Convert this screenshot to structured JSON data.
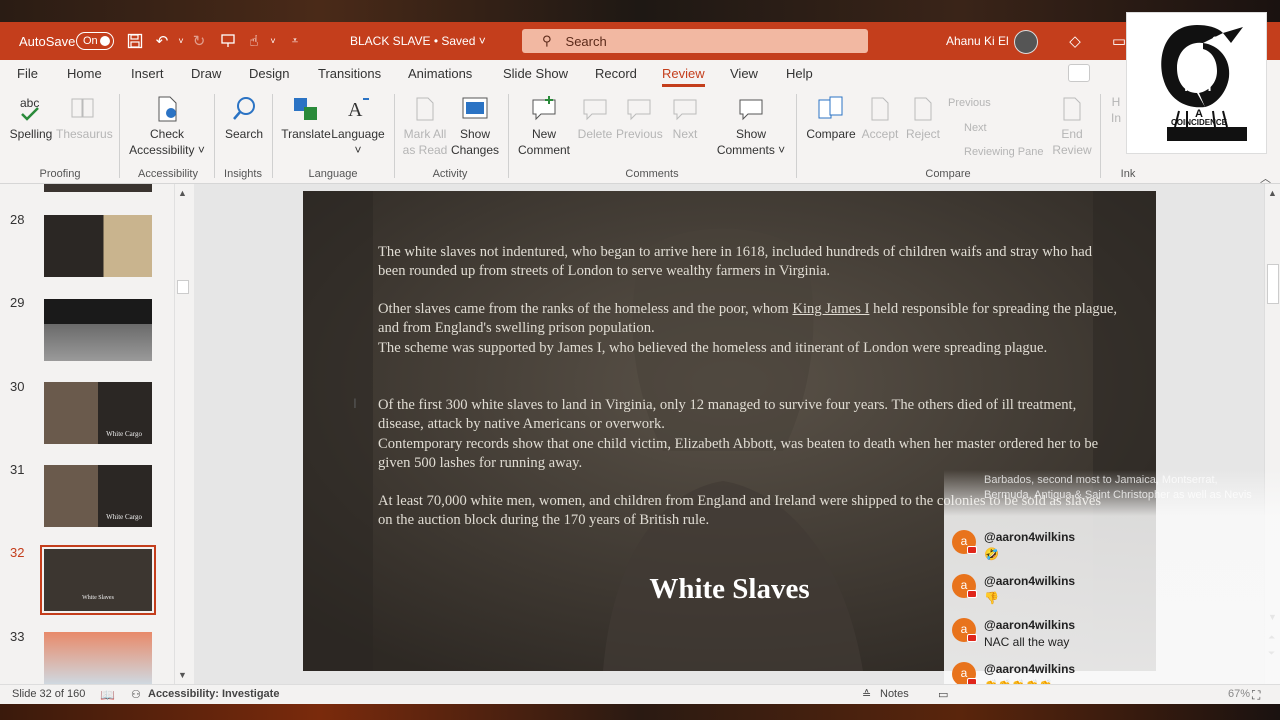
{
  "titlebar": {
    "autosave_label": "AutoSave",
    "autosave_state": "On",
    "doc_title": "BLACK SLAVE • Saved",
    "search_placeholder": "Search",
    "user_name": "Ahanu Ki El"
  },
  "tabs": [
    "File",
    "Home",
    "Insert",
    "Draw",
    "Design",
    "Transitions",
    "Animations",
    "Slide Show",
    "Record",
    "Review",
    "View",
    "Help"
  ],
  "active_tab": "Review",
  "ribbon": {
    "groups": {
      "proofing": "Proofing",
      "accessibility": "Accessibility",
      "insights": "Insights",
      "language": "Language",
      "activity": "Activity",
      "comments": "Comments",
      "compare": "Compare",
      "ink": "Ink"
    },
    "buttons": {
      "spelling": "Spelling",
      "thesaurus": "Thesaurus",
      "check_accessibility_1": "Check",
      "check_accessibility_2": "Accessibility ˅",
      "search": "Search",
      "translate": "Translate",
      "language": "Language",
      "language_arrow": "˅",
      "mark_all_1": "Mark All",
      "mark_all_2": "as Read",
      "show_changes_1": "Show",
      "show_changes_2": "Changes",
      "new_comment_1": "New",
      "new_comment_2": "Comment",
      "delete": "Delete",
      "previous": "Previous",
      "next": "Next",
      "show_comments_1": "Show",
      "show_comments_2": "Comments ˅",
      "compare": "Compare",
      "accept": "Accept",
      "reject": "Reject",
      "small_previous": "Previous",
      "small_next": "Next",
      "reviewing_pane": "Reviewing Pane",
      "end_review_1": "End",
      "end_review_2": "Review",
      "ink_1": "H",
      "ink_2": "In"
    }
  },
  "slides_panel": {
    "numbers": [
      "28",
      "29",
      "30",
      "31",
      "32",
      "33"
    ],
    "selected": "32",
    "thumb_30_text": "White Cargo",
    "thumb_31_text": "White Cargo",
    "thumb_32_text": "White Slaves"
  },
  "slide": {
    "p1": "The white slaves not indentured, who began to arrive here in 1618, included hundreds of children waifs and stray who had been rounded up from streets of London to serve wealthy farmers in Virginia.",
    "p2a": "Other slaves came from the ranks of the homeless and the poor, whom ",
    "p2_link": "King James I",
    "p2b": " held responsible for spreading the plague, and from England's swelling prison population.",
    "p3": "The scheme was supported by James I, who believed the homeless and itinerant of London were spreading plague.",
    "p4": "Of the first 300 white slaves to land in Virginia, only 12  managed to survive four years. The others died of ill treatment, disease, attack by native Americans or overwork.",
    "p5": "Contemporary records show that one child victim, Elizabeth Abbott, was beaten to death when her master ordered her to be given 500 lashes for running away.",
    "p6": "At least 70,000 white men, women, and children from England and Ireland were shipped to the colonies to be sold as slaves on the auction block during the 170 years of British rule.",
    "title": "White Slaves"
  },
  "logo": {
    "text_not": "NOT",
    "text_a": "A",
    "text_coincidence": "COINCIDENCE"
  },
  "chat": {
    "faded_text": "Barbados, second most to Jamaica, Montserrat, Bermuda, Antigua & Saint Christopher as well as Nevis",
    "messages": [
      {
        "avatar": "a",
        "user": "@aaron4wilkins",
        "text": "🤣"
      },
      {
        "avatar": "a",
        "user": "@aaron4wilkins",
        "text": "👎"
      },
      {
        "avatar": "a",
        "user": "@aaron4wilkins",
        "text": "NAC all the way"
      },
      {
        "avatar": "a",
        "user": "@aaron4wilkins",
        "text": "👏👏👏👏👏"
      }
    ]
  },
  "statusbar": {
    "slide_count": "Slide 32 of 160",
    "accessibility": "Accessibility: Investigate",
    "notes": "Notes",
    "zoom": "67%"
  },
  "colors": {
    "accent": "#c43e1c",
    "ribbon_bg": "#f5f3f2",
    "slide_bg": "#3c3630"
  }
}
